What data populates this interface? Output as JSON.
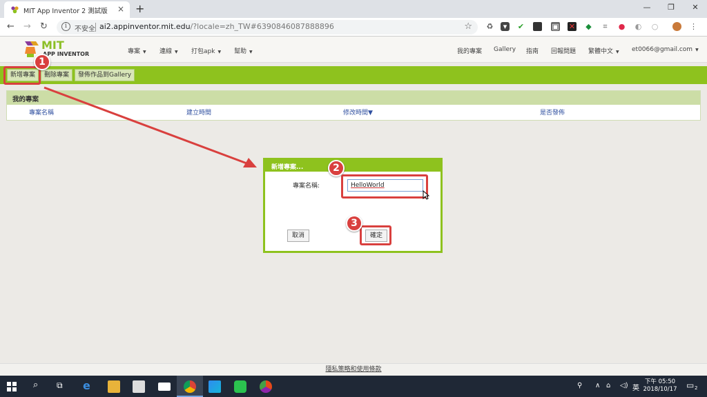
{
  "browser": {
    "tab_title": "MIT App Inventor 2 測試版",
    "insecure_label": "不安全",
    "url_host": "ai2.appinventor.mit.edu",
    "url_rest": "/?locale=zh_TW#6390846087888896"
  },
  "app": {
    "logo_main": "MIT",
    "logo_sub": "APP INVENTOR",
    "menu": [
      "專案",
      "連線",
      "打包apk",
      "幫助"
    ],
    "right_links": [
      "我的專案",
      "Gallery",
      "指南",
      "回報問題",
      "繁體中文",
      "et0066@gmail.com"
    ]
  },
  "toolbar": {
    "new_project": "新增專案",
    "delete_project": "刪除專案",
    "publish_gallery": "發佈作品到Gallery"
  },
  "projects_panel": {
    "title": "我的專案",
    "columns": [
      "專案名稱",
      "建立時間",
      "修改時間▼",
      "是否發佈"
    ]
  },
  "dialog": {
    "title": "新增專案...",
    "name_label": "專案名稱:",
    "name_value": "HelloWorld",
    "cancel": "取消",
    "ok": "確定"
  },
  "annotations": [
    "1",
    "2",
    "3"
  ],
  "footer": {
    "link": "隱私策略和使用條款"
  },
  "taskbar": {
    "ime": "英",
    "time": "下午 05:50",
    "date": "2018/10/17",
    "notifications": "2"
  },
  "colors": {
    "accent_green": "#8ec21e",
    "annotation_red": "#d9403e"
  }
}
